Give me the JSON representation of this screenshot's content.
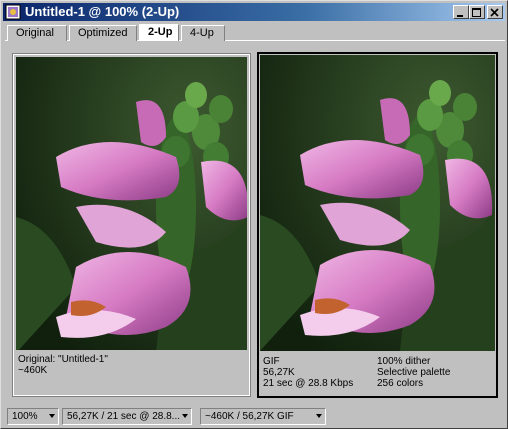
{
  "window": {
    "title": "Untitled-1 @ 100% (2-Up)",
    "app_icon": "photoshop-doc-icon",
    "controls": [
      "minimize-icon",
      "maximize-icon",
      "close-icon"
    ]
  },
  "tabs": [
    {
      "label": "Original",
      "active": false
    },
    {
      "label": "Optimized",
      "active": false
    },
    {
      "label": "2-Up",
      "active": true
    },
    {
      "label": "4-Up",
      "active": false
    }
  ],
  "left_panel": {
    "line1": "Original: \"Untitled-1\"",
    "line2": "~460K"
  },
  "right_panel": {
    "col1": [
      "GIF",
      "56,27K",
      "21 sec @ 28.8 Kbps"
    ],
    "col2": [
      "100% dither",
      "Selective palette",
      "256 colors"
    ]
  },
  "status": {
    "zoom": "100%",
    "download": "56,27K / 21 sec @ 28.8...",
    "size": "~460K / 56,27K GIF"
  },
  "colors": {
    "titlebar_start": "#0a246a",
    "titlebar_end": "#a6caf0",
    "chrome": "#c0c0c0",
    "petal": "#d67bc4",
    "leaf": "#2f5a24"
  }
}
